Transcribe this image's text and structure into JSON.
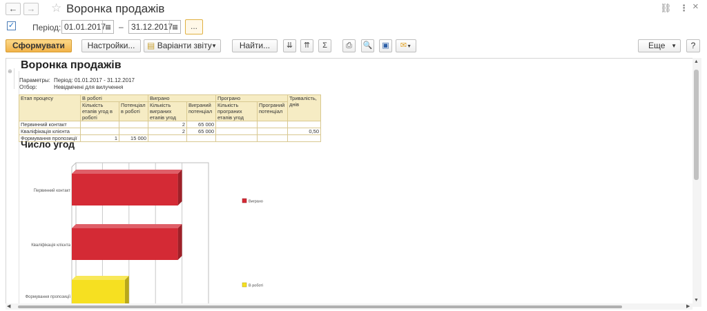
{
  "window": {
    "title": "Воронка продажів",
    "back_icon": "←",
    "forward_icon": "→",
    "link_icon": "🔗",
    "menu_icon": "⋮",
    "close_icon": "×"
  },
  "period": {
    "label": "Період:",
    "checked": true,
    "from": "01.01.2017",
    "separator": "–",
    "to": "31.12.2017",
    "more": "..."
  },
  "toolbar": {
    "generate": "Сформувати",
    "settings": "Настройки...",
    "variants": "Варіанти звіту",
    "find": "Найти...",
    "more": "Еще",
    "help": "?"
  },
  "report": {
    "title": "Воронка продажів",
    "params_label": "Параметры:",
    "params_value": "Період: 01.01.2017 - 31.12.2017",
    "filter_label": "Отбор:",
    "filter_value": "Невідмічені для вилучення",
    "table": {
      "h_stage": "Етап процесу",
      "h_inwork": "В роботі",
      "h_won": "Виграно",
      "h_lost": "Програно",
      "h_duration": "Тривалість, днів",
      "h_count_inwork": "Кількість етапів угод в роботі",
      "h_potential_inwork": "Потенціал в роботі",
      "h_count_won": "Кількість виграних етапів угод",
      "h_potential_won": "Виграний потенціал",
      "h_count_lost": "Кількість програних етапів угод",
      "h_potential_lost": "Програний потенціал",
      "rows": [
        {
          "stage": "Первинний контакт",
          "count_inwork": "",
          "potential_inwork": "",
          "count_won": "2",
          "potential_won": "65 000",
          "count_lost": "",
          "potential_lost": "",
          "duration": ""
        },
        {
          "stage": "Кваліфікація клієнта",
          "count_inwork": "",
          "potential_inwork": "",
          "count_won": "2",
          "potential_won": "65 000",
          "count_lost": "",
          "potential_lost": "",
          "duration": "0,50"
        },
        {
          "stage": "Формування пропозиції",
          "count_inwork": "1",
          "potential_inwork": "15 000",
          "count_won": "",
          "potential_won": "",
          "count_lost": "",
          "potential_lost": "",
          "duration": ""
        }
      ]
    },
    "chart_title": "Число угод"
  },
  "chart_data": {
    "type": "bar",
    "orientation": "horizontal",
    "stacked": true,
    "title": "Число угод",
    "categories": [
      "Первинний контакт",
      "Кваліфікація клієнта",
      "Формування пропозиції"
    ],
    "series": [
      {
        "name": "Виграно",
        "values": [
          2,
          2,
          0
        ],
        "color": "#d42a35"
      },
      {
        "name": "В роботі",
        "values": [
          0,
          0,
          1
        ],
        "color": "#f6e021"
      }
    ],
    "xlim": [
      0,
      2.5
    ],
    "legend": "right"
  }
}
